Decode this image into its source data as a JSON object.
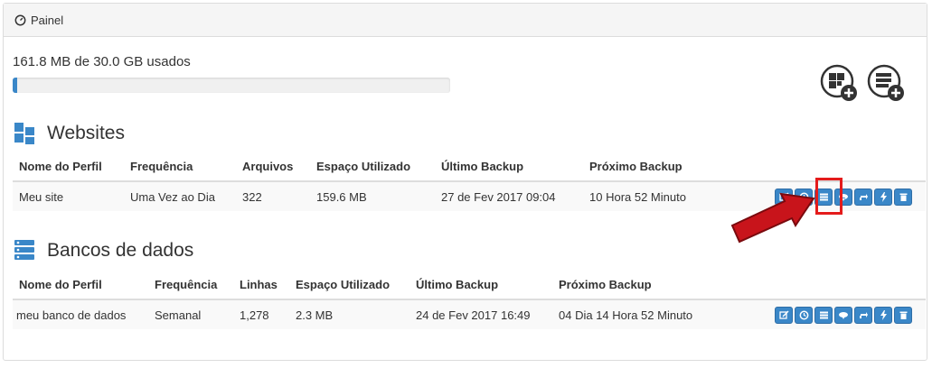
{
  "panel": {
    "title": "Painel"
  },
  "usage": {
    "text": "161.8 MB de 30.0 GB usados",
    "fraction": 0.005
  },
  "buttons": {
    "add_website": "add-website",
    "add_database": "add-database"
  },
  "websites": {
    "title": "Websites",
    "headers": [
      "Nome do Perfil",
      "Frequência",
      "Arquivos",
      "Espaço Utilizado",
      "Último Backup",
      "Próximo Backup"
    ],
    "rows": [
      {
        "name": "Meu site",
        "frequency": "Uma Vez ao Dia",
        "count": "322",
        "space": "159.6 MB",
        "last": "27 de Fev 2017 09:04",
        "next": "10 Hora 52 Minuto"
      }
    ]
  },
  "databases": {
    "title": "Bancos de dados",
    "headers": [
      "Nome do Perfil",
      "Frequência",
      "Linhas",
      "Espaço Utilizado",
      "Último Backup",
      "Próximo Backup"
    ],
    "rows": [
      {
        "name": "meu banco de dados",
        "frequency": "Semanal",
        "count": "1,278",
        "space": "2.3 MB",
        "last": "24 de Fev 2017 16:49",
        "next": "04 Dia 14 Hora 52 Minuto"
      }
    ]
  },
  "colors": {
    "accent": "#3a87c8",
    "highlight": "#e41b1b"
  },
  "action_icons": [
    "edit-icon",
    "clock-icon",
    "list-icon",
    "cloud-download-icon",
    "refresh-icon",
    "bolt-icon",
    "trash-icon"
  ]
}
